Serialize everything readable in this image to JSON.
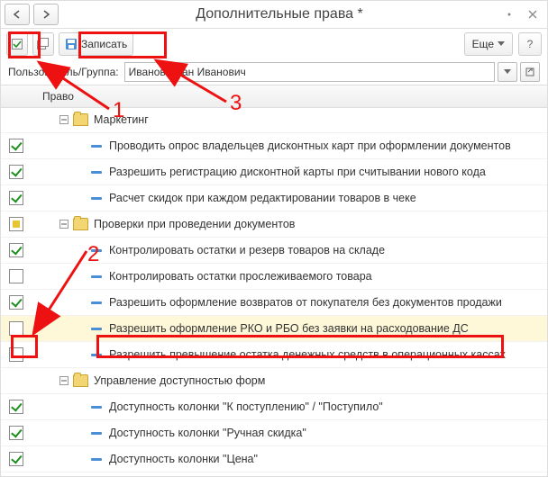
{
  "titlebar": {
    "title": "Дополнительные права *"
  },
  "toolbar": {
    "record_label": "Записать",
    "more_label": "Еще"
  },
  "user_row": {
    "label": "Пользователь/Группа:",
    "value": "Иванов Иван Иванович"
  },
  "tree_header": {
    "column": "Право"
  },
  "rows": [
    {
      "cb": "none",
      "indent": 30,
      "expander": "minus",
      "folder": true,
      "dash": false,
      "label": "Маркетинг"
    },
    {
      "cb": "checked",
      "indent": 66,
      "expander": "",
      "folder": false,
      "dash": true,
      "label": "Проводить опрос владельцев дисконтных карт при оформлении документов"
    },
    {
      "cb": "checked",
      "indent": 66,
      "expander": "",
      "folder": false,
      "dash": true,
      "label": "Разрешить регистрацию дисконтной карты при считывании нового кода"
    },
    {
      "cb": "checked",
      "indent": 66,
      "expander": "",
      "folder": false,
      "dash": true,
      "label": "Расчет скидок при каждом редактировании товаров в чеке"
    },
    {
      "cb": "square",
      "indent": 30,
      "expander": "minus",
      "folder": true,
      "dash": false,
      "label": "Проверки при проведении документов"
    },
    {
      "cb": "checked",
      "indent": 66,
      "expander": "",
      "folder": false,
      "dash": true,
      "label": "Контролировать остатки и резерв товаров на складе"
    },
    {
      "cb": "none",
      "indent": 66,
      "expander": "",
      "folder": false,
      "dash": true,
      "label": "Контролировать остатки прослеживаемого товара"
    },
    {
      "cb": "checked",
      "indent": 66,
      "expander": "",
      "folder": false,
      "dash": true,
      "label": "Разрешить оформление возвратов от покупателя без документов продажи"
    },
    {
      "cb": "none",
      "indent": 66,
      "expander": "",
      "folder": false,
      "dash": true,
      "label": "Разрешить оформление РКО и РБО без заявки на расходование ДС",
      "sel": true
    },
    {
      "cb": "none",
      "indent": 66,
      "expander": "",
      "folder": false,
      "dash": true,
      "label": "Разрешить превышение остатка денежных средств в операционных кассах"
    },
    {
      "cb": "none",
      "indent": 30,
      "expander": "minus",
      "folder": true,
      "dash": false,
      "label": "Управление доступностью форм"
    },
    {
      "cb": "checked",
      "indent": 66,
      "expander": "",
      "folder": false,
      "dash": true,
      "label": "Доступность колонки \"К поступлению\" / \"Поступило\""
    },
    {
      "cb": "checked",
      "indent": 66,
      "expander": "",
      "folder": false,
      "dash": true,
      "label": "Доступность колонки \"Ручная скидка\""
    },
    {
      "cb": "checked",
      "indent": 66,
      "expander": "",
      "folder": false,
      "dash": true,
      "label": "Доступность колонки \"Цена\""
    }
  ],
  "annotations": {
    "n1": "1",
    "n2": "2",
    "n3": "3"
  }
}
